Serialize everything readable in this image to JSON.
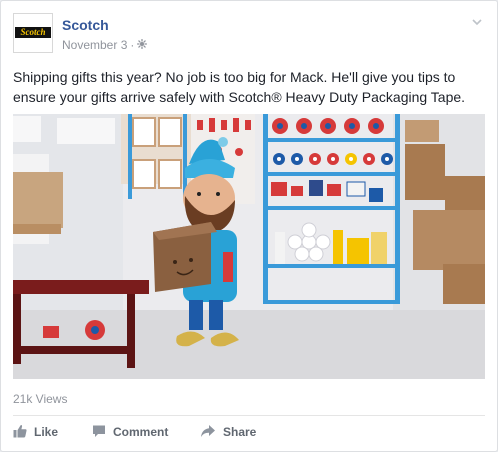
{
  "post": {
    "page_name": "Scotch",
    "logo_text": "Scotch",
    "date": "November 3",
    "separator": "·",
    "audience_icon": "globe-icon",
    "message": "Shipping gifts this year? No job is too big for Mack. He'll give you tips to ensure your gifts arrive safely with Scotch® Heavy Duty Packaging Tape.",
    "views": "21k Views"
  },
  "actions": {
    "like": "Like",
    "comment": "Comment",
    "share": "Share"
  },
  "colors": {
    "link": "#365899",
    "muted": "#90949c",
    "action": "#606770",
    "scotch_yellow": "#f5c400",
    "shelf_blue": "#3a9ad9"
  }
}
